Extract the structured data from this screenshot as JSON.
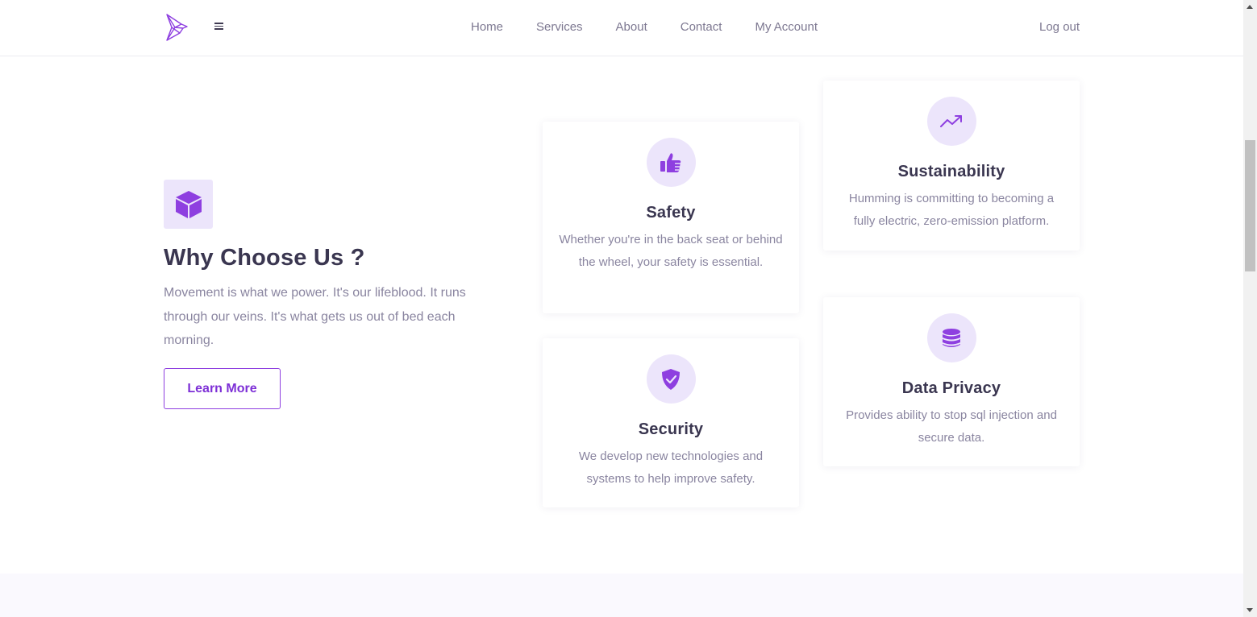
{
  "header": {
    "logo": "hummingbird-logo",
    "menu_icon": "hamburger-icon",
    "nav": [
      "Home",
      "Services",
      "About",
      "Contact",
      "My Account"
    ],
    "logout": "Log out"
  },
  "hero": {
    "icon": "cube-icon",
    "title": "Why Choose Us ?",
    "description": "Movement is what we power. It's our lifeblood. It runs through our veins. It's what gets us out of bed each morning.",
    "button_label": "Learn More"
  },
  "features": {
    "safety": {
      "icon": "thumbs-up-icon",
      "title": "Safety",
      "text": "Whether you're in the back seat or behind the wheel, your safety is essential."
    },
    "security": {
      "icon": "shield-check-icon",
      "title": "Security",
      "text": "We develop new technologies and systems to help improve safety."
    },
    "sustainability": {
      "icon": "trending-up-icon",
      "title": "Sustainability",
      "text": "Humming is committing to becoming a fully electric, zero-emission platform."
    },
    "privacy": {
      "icon": "database-icon",
      "title": "Data Privacy",
      "text": "Provides ability to stop sql injection and secure data."
    }
  },
  "colors": {
    "accent": "#8e3fe0",
    "icon_bg": "#ece5fb",
    "heading": "#3a3650",
    "body_text": "#8a85a0"
  }
}
